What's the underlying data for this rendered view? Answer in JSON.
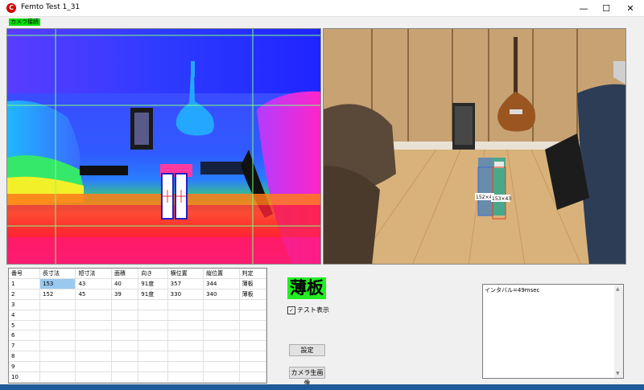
{
  "window": {
    "title": "Femto Test 1_31",
    "controls": {
      "minimize": "—",
      "maximize": "☐",
      "close": "✕"
    }
  },
  "camera_status": "カメラ接続",
  "rgb_labels": {
    "left_box": "152×45",
    "right_box": "153×43"
  },
  "table": {
    "headers": [
      "番号",
      "長寸法",
      "短寸法",
      "面積",
      "向き",
      "横位置",
      "縦位置",
      "判定"
    ],
    "rows": [
      [
        "1",
        "153",
        "43",
        "40",
        "91度",
        "357",
        "344",
        "薄板"
      ],
      [
        "2",
        "152",
        "45",
        "39",
        "91度",
        "330",
        "340",
        "薄板"
      ],
      [
        "3",
        "",
        "",
        "",
        "",
        "",
        "",
        ""
      ],
      [
        "4",
        "",
        "",
        "",
        "",
        "",
        "",
        ""
      ],
      [
        "5",
        "",
        "",
        "",
        "",
        "",
        "",
        ""
      ],
      [
        "6",
        "",
        "",
        "",
        "",
        "",
        "",
        ""
      ],
      [
        "7",
        "",
        "",
        "",
        "",
        "",
        "",
        ""
      ],
      [
        "8",
        "",
        "",
        "",
        "",
        "",
        "",
        ""
      ],
      [
        "9",
        "",
        "",
        "",
        "",
        "",
        "",
        ""
      ],
      [
        "10",
        "",
        "",
        "",
        "",
        "",
        "",
        ""
      ]
    ]
  },
  "judgement": "薄板",
  "test_display": {
    "label": "テスト表示",
    "checked": true
  },
  "buttons": {
    "settings": "設定",
    "camera_raw": "カメラ生画像"
  },
  "log_text": "インタバル=49msec",
  "colors": {
    "judge_bg": "#22ee22",
    "status_bg": "#00e000",
    "selected_cell": "#99c9ef"
  },
  "icons": {
    "app": "app-logo-icon",
    "scroll_up": "scroll-up-icon",
    "scroll_down": "scroll-down-icon"
  }
}
